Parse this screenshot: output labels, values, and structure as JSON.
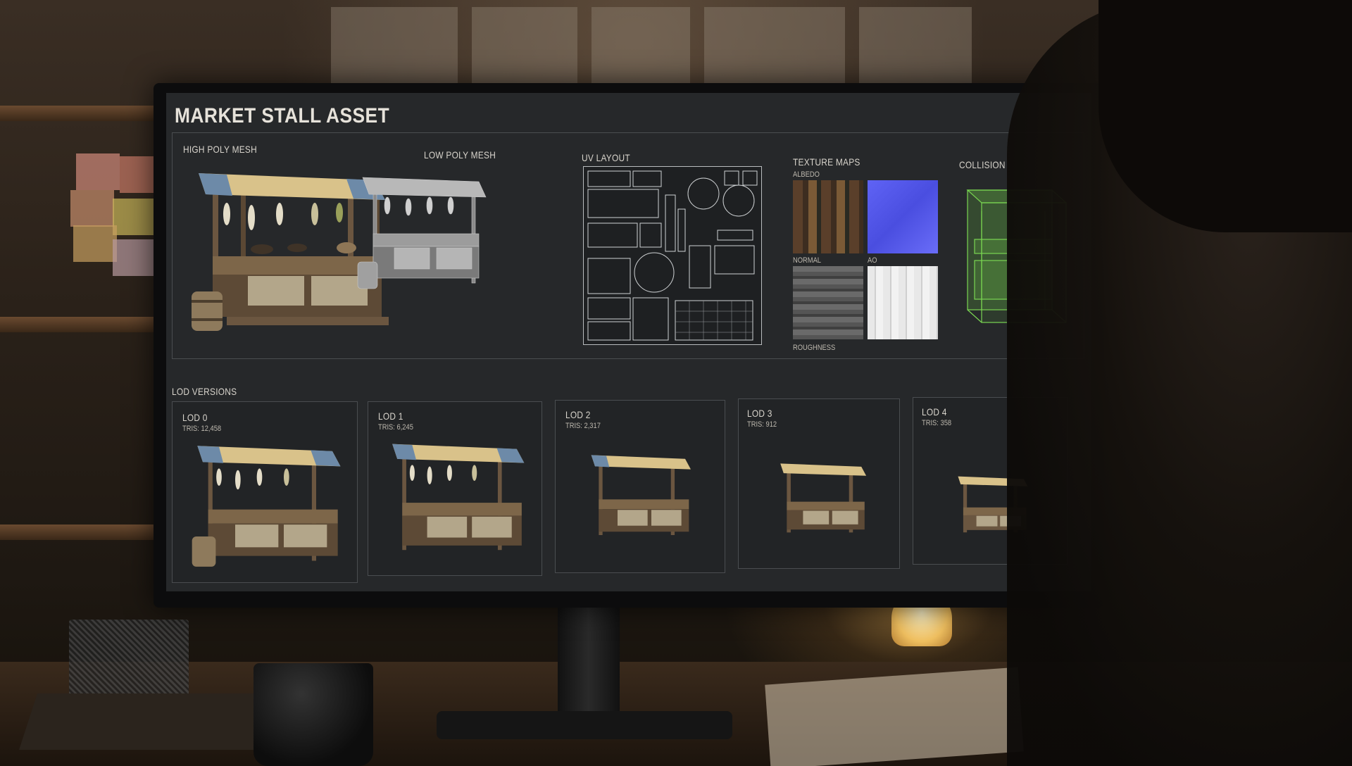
{
  "header": {
    "title": "MARKET STALL ASSET"
  },
  "sections": {
    "high_poly": "HIGH POLY MESH",
    "low_poly": "LOW POLY MESH",
    "uv_layout": "UV LAYOUT",
    "texture_maps": "TEXTURE MAPS",
    "collision": "COLLISION",
    "lod_versions": "LOD VERSIONS"
  },
  "textures": {
    "albedo": "ALBEDO",
    "normal": "NORMAL",
    "ao": "AO",
    "roughness": "ROUGHNESS"
  },
  "lods": [
    {
      "label": "LOD 0",
      "tris": "TRIS: 12,458"
    },
    {
      "label": "LOD 1",
      "tris": "TRIS: 6,245"
    },
    {
      "label": "LOD 2",
      "tris": "TRIS: 2,317"
    },
    {
      "label": "LOD 3",
      "tris": "TRIS: 912"
    },
    {
      "label": "LOD 4",
      "tris": "TRIS: 358"
    }
  ],
  "colors": {
    "normal_map": "#5a5cf0",
    "collision": "#6fc24a",
    "awning": "#d9c28a",
    "awning_stripe": "#6d8aa8"
  },
  "icons": [
    "market-stall-model",
    "uv-grid",
    "collision-mesh"
  ]
}
